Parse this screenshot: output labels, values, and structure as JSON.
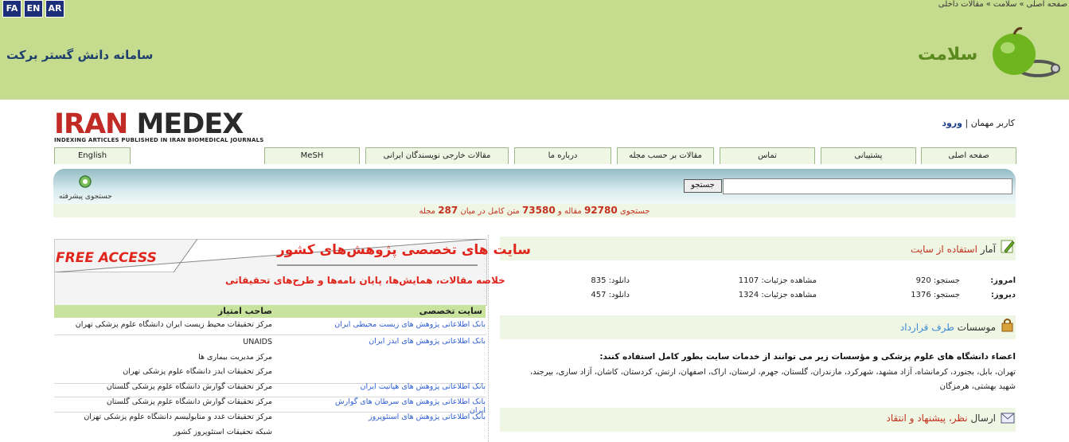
{
  "lang_buttons": [
    "FA",
    "EN",
    "AR"
  ],
  "breadcrumb": [
    "صفحه اصلی",
    "سلامت",
    "مقالات داخلی"
  ],
  "breadcrumb_sep": "»",
  "system_title": "سامانه دانش گستر برکت",
  "brand_name": "سلامت",
  "logo": {
    "part1": "IRAN",
    "part2": "MEDEX",
    "subtitle": "INDEXING ARTICLES PUBLISHED IN IRAN BIOMEDICAL JOURNALS"
  },
  "user": {
    "guest": "کاربر مهمان",
    "sep": "|",
    "login": "ورود"
  },
  "tabs": [
    "صفحه اصلی",
    "پشتیبانی",
    "تماس",
    "مقالات بر حسب مجله",
    "درباره ما",
    "مقالات خارجی نویسندگان ایرانی",
    "MeSH",
    "English"
  ],
  "search": {
    "button": "جستجو",
    "advanced": "جستجوی پیشرفته"
  },
  "stats_line": {
    "prefix": "جستجوی",
    "articles": "92780",
    "mid1": "مقاله و",
    "fulltext": "73580",
    "mid2": "متن کامل در میان",
    "journals": "287",
    "suffix": "مجله"
  },
  "usage": {
    "title_a": "آمار",
    "title_b": "استفاده از سایت",
    "today_label": "امروز:",
    "yesterday_label": "دیروز:",
    "today": [
      "جستجو: 920",
      "مشاهده جزئیات: 1107",
      "دانلود: 835"
    ],
    "yesterday": [
      "جستجو: 1376",
      "مشاهده جزئیات: 1324",
      "دانلود: 457"
    ]
  },
  "contract": {
    "title_a": "موسسات",
    "title_b": "طرف قرارداد",
    "intro": "اعضاء دانشگاه های علوم پزشکی و مؤسسات زیر می توانند از خدمات سایت بطور کامل استفاده کنند:",
    "list": "تهران، بابل، بجنورد، کرمانشاه، آزاد مشهد، شهرکرد، مازندران، گلستان، جهرم، لرستان، اراک، اصفهان، ارتش، کردستان، کاشان، آزاد ساری، بیرجند، شهید بهشتی، هرمزگان"
  },
  "feedback": {
    "title_a": "ارسال",
    "title_b": "نظر، پیشنهاد و انتقاد"
  },
  "free_access": "FREE ACCESS",
  "specialized_sites": {
    "title": "سایت های تخصصی پژوهش‌های کشور",
    "subtitle": "خلاصه مقالات، همایش‌ها، پایان نامه‌ها و طرح‌های تحقیقاتی",
    "col_site": "سایت تخصصی",
    "col_owner": "صاحب امتیاز",
    "rows": [
      {
        "site": "بانک اطلاعاتی پژوهش های زیست محیطی ایران",
        "owner": "مرکز تحقیقات محیط زیست ایران دانشگاه علوم پزشکی تهران"
      },
      {
        "site": "بانک اطلاعاتی پژوهش های ایدز ایران",
        "owner": "UNAIDS"
      },
      {
        "site": "",
        "owner": "مرکز مدیریت بیماری ها"
      },
      {
        "site": "",
        "owner": "مرکز تحقیقات ایدز دانشگاه علوم پزشکی تهران"
      },
      {
        "site": "بانک اطلاعاتی پژوهش های هپاتیت ایران",
        "owner": "مرکز تحقیقات گوارش دانشگاه علوم پزشکی گلستان"
      },
      {
        "site": "بانک اطلاعاتی پژوهش های سرطان های گوارش ایران",
        "owner": "مرکز تحقیقات گوارش دانشگاه علوم پزشکی گلستان"
      },
      {
        "site": "بانک اطلاعاتی پژوهش های استئوپروز",
        "owner": "مرکز تحقیقات غدد و متابولیسم دانشگاه علوم پزشکی تهران"
      },
      {
        "site": "",
        "owner": "شبکه تحقیقات استئوپروز کشور"
      }
    ]
  },
  "colors": {
    "header_green": "#c5db8e",
    "accent_red": "#c2311f",
    "link_blue": "#2e5fd4"
  }
}
